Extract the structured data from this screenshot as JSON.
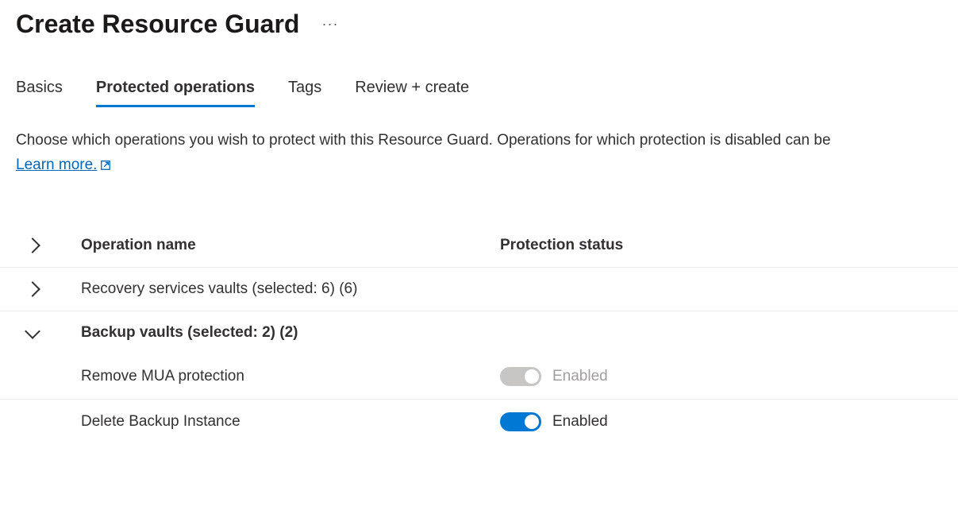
{
  "header": {
    "title": "Create Resource Guard",
    "more_label": "..."
  },
  "tabs": [
    {
      "label": "Basics",
      "active": false
    },
    {
      "label": "Protected operations",
      "active": true
    },
    {
      "label": "Tags",
      "active": false
    },
    {
      "label": "Review + create",
      "active": false
    }
  ],
  "description": {
    "text": "Choose which operations you wish to protect with this Resource Guard. Operations for which protection is disabled can be",
    "learn_more": "Learn more."
  },
  "table": {
    "columns": {
      "name": "Operation name",
      "status": "Protection status"
    },
    "groups": [
      {
        "label": "Recovery services vaults (selected: 6) (6)",
        "expanded": false
      },
      {
        "label": "Backup vaults (selected: 2) (2)",
        "expanded": true,
        "items": [
          {
            "name": "Remove MUA protection",
            "status": "Enabled",
            "toggle_on": false,
            "disabled": true
          },
          {
            "name": "Delete Backup Instance",
            "status": "Enabled",
            "toggle_on": true,
            "disabled": false
          }
        ]
      }
    ]
  },
  "colors": {
    "accent": "#0078d4",
    "link": "#0067b8"
  }
}
